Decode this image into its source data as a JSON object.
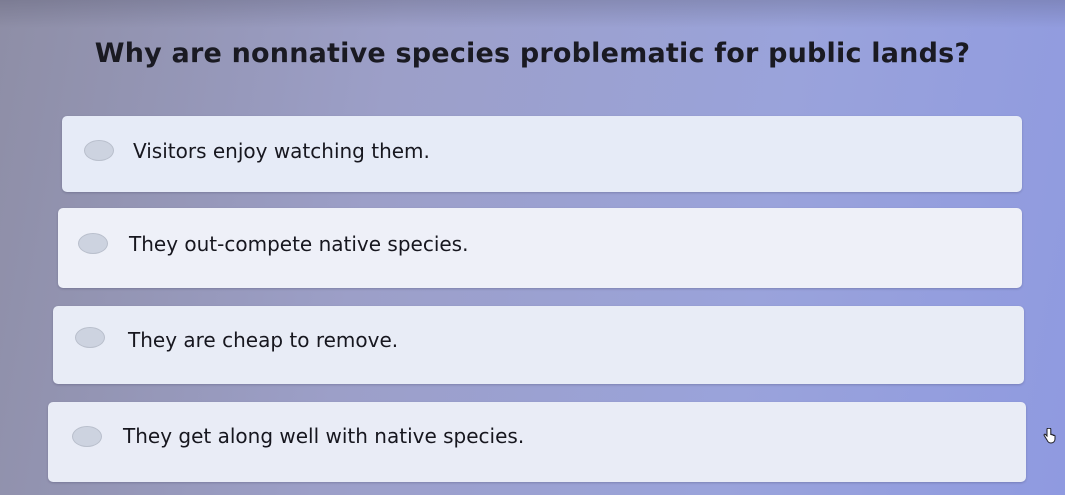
{
  "question": {
    "text": "Why are nonnative species problematic for public lands?"
  },
  "options": [
    {
      "label": "Visitors enjoy watching them."
    },
    {
      "label": "They out-compete native species."
    },
    {
      "label": "They are cheap to remove."
    },
    {
      "label": "They get along well with native species."
    }
  ],
  "icons": {
    "radio": "radio-icon",
    "cursor": "hand-pointer-icon"
  }
}
